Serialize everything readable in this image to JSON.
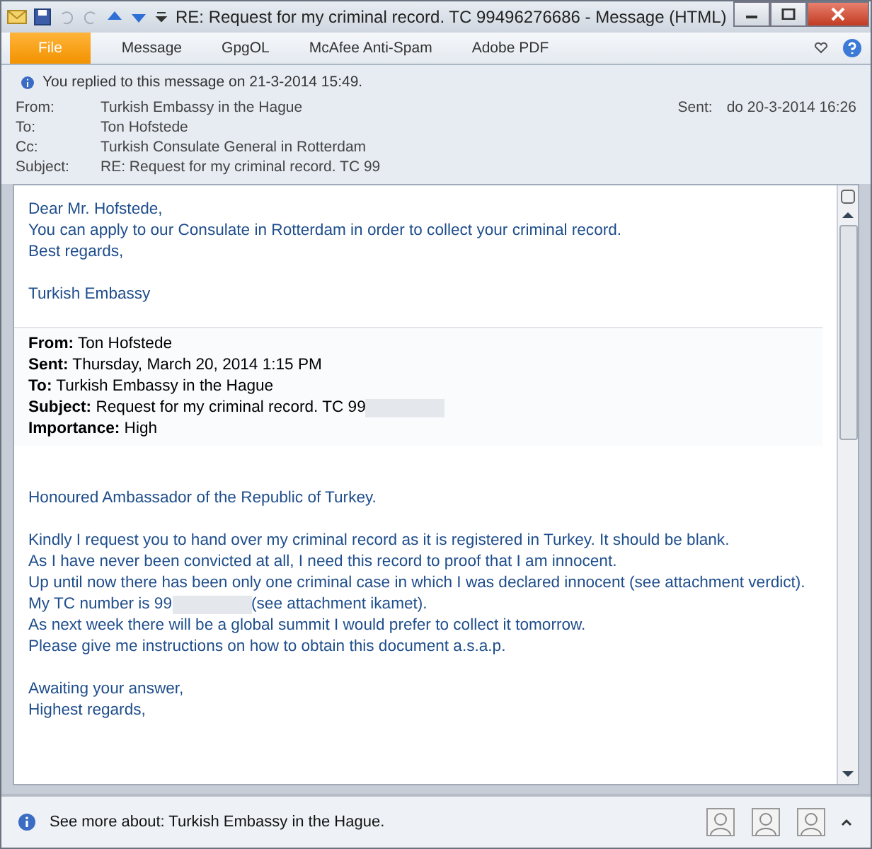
{
  "window": {
    "title": "RE: Request for my criminal record. TC 99496276686  -  Message (HTML)"
  },
  "tabs": [
    {
      "label": "File",
      "kind": "file"
    },
    {
      "label": "Message",
      "kind": "tab"
    },
    {
      "label": "GpgOL",
      "kind": "tab"
    },
    {
      "label": "McAfee Anti-Spam",
      "kind": "tab"
    },
    {
      "label": "Adobe PDF",
      "kind": "tab"
    }
  ],
  "info_bar": "You replied to this message on 21-3-2014 15:49.",
  "headers": [
    {
      "label": "From:",
      "value": "Turkish Embassy in the Hague"
    },
    {
      "label": "To:",
      "value": "Ton Hofstede"
    },
    {
      "label": "Cc:",
      "value": "Turkish Consulate General in Rotterdam"
    },
    {
      "label": "Subject:",
      "value": "RE: Request for my criminal record. TC 99"
    }
  ],
  "sent": {
    "label": "Sent:",
    "value": "do 20-3-2014 16:26"
  },
  "reply": [
    [
      {
        "text": "Dear Mr. Hofstede,"
      },
      {
        "text": "You can apply to our Consulate in Rotterdam in order to collect your criminal record."
      },
      {
        "text": "Best regards,"
      }
    ],
    [
      {
        "text": "Turkish Embassy"
      }
    ]
  ],
  "quoted_headers": [
    {
      "label": "From:",
      "value": "Ton Hofstede"
    },
    {
      "label": "Sent:",
      "value": "Thursday, March 20, 2014 1:15 PM"
    },
    {
      "label": "To:",
      "value": "Turkish Embassy in the Hague"
    },
    {
      "label": "Subject:",
      "value": "Request for my criminal record. TC 99",
      "redacted": true
    },
    {
      "label": "Importance:",
      "value": "High"
    }
  ],
  "quoted": [
    [
      {
        "text": "Honoured Ambassador of the Republic of Turkey."
      }
    ],
    [
      {
        "text": "Kindly I request you to hand over my criminal record as it is registered in Turkey. It should be blank."
      },
      {
        "text": "As I have never been convicted at all,  I need this record to proof that I am innocent."
      },
      {
        "text": "Up until now there has been only one criminal case in which I was declared innocent (see attachment verdict)."
      },
      {
        "text": "My TC number is 99",
        "redacted": true,
        "after": "(see attachment ikamet)."
      },
      {
        "text": "As next week there will be a global summit I would prefer to collect it tomorrow."
      },
      {
        "text": "Please give me instructions on how to obtain this document a.s.a.p."
      }
    ],
    [
      {
        "text": "Awaiting your answer,"
      },
      {
        "text": "Highest regards,"
      }
    ]
  ],
  "people_pane": {
    "text": "See more about: Turkish Embassy in the Hague."
  }
}
